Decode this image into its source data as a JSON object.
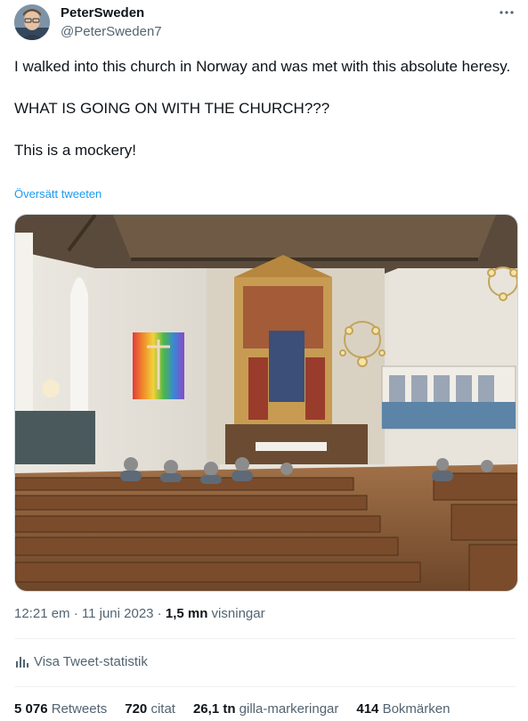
{
  "author": {
    "display_name": "PeterSweden",
    "handle": "@PeterSweden7"
  },
  "more_icon": "more-horizontal-icon",
  "tweet": {
    "paragraphs": [
      "I walked into this church in Norway and was met with this absolute heresy.",
      "WHAT IS GOING ON WITH THE CHURCH???",
      "This is a mockery!"
    ],
    "translate_link": "Översätt tweeten"
  },
  "meta": {
    "time": "12:21 em",
    "separator": " · ",
    "date": "11 juni 2023",
    "views_count": "1,5 mn",
    "views_label": " visningar"
  },
  "analytics": {
    "icon": "bar-chart-icon",
    "label": "Visa Tweet-statistik"
  },
  "engagement": [
    {
      "count": "5 076",
      "label": " Retweets"
    },
    {
      "count": "720",
      "label": " citat"
    },
    {
      "count": "26,1 tn",
      "label": " gilla-markeringar"
    },
    {
      "count": "414",
      "label": " Bokmärken"
    }
  ],
  "colors": {
    "link": "#1d9bf0",
    "secondary_text": "#536471",
    "primary_text": "#0f1419",
    "divider": "#eff3f4"
  }
}
